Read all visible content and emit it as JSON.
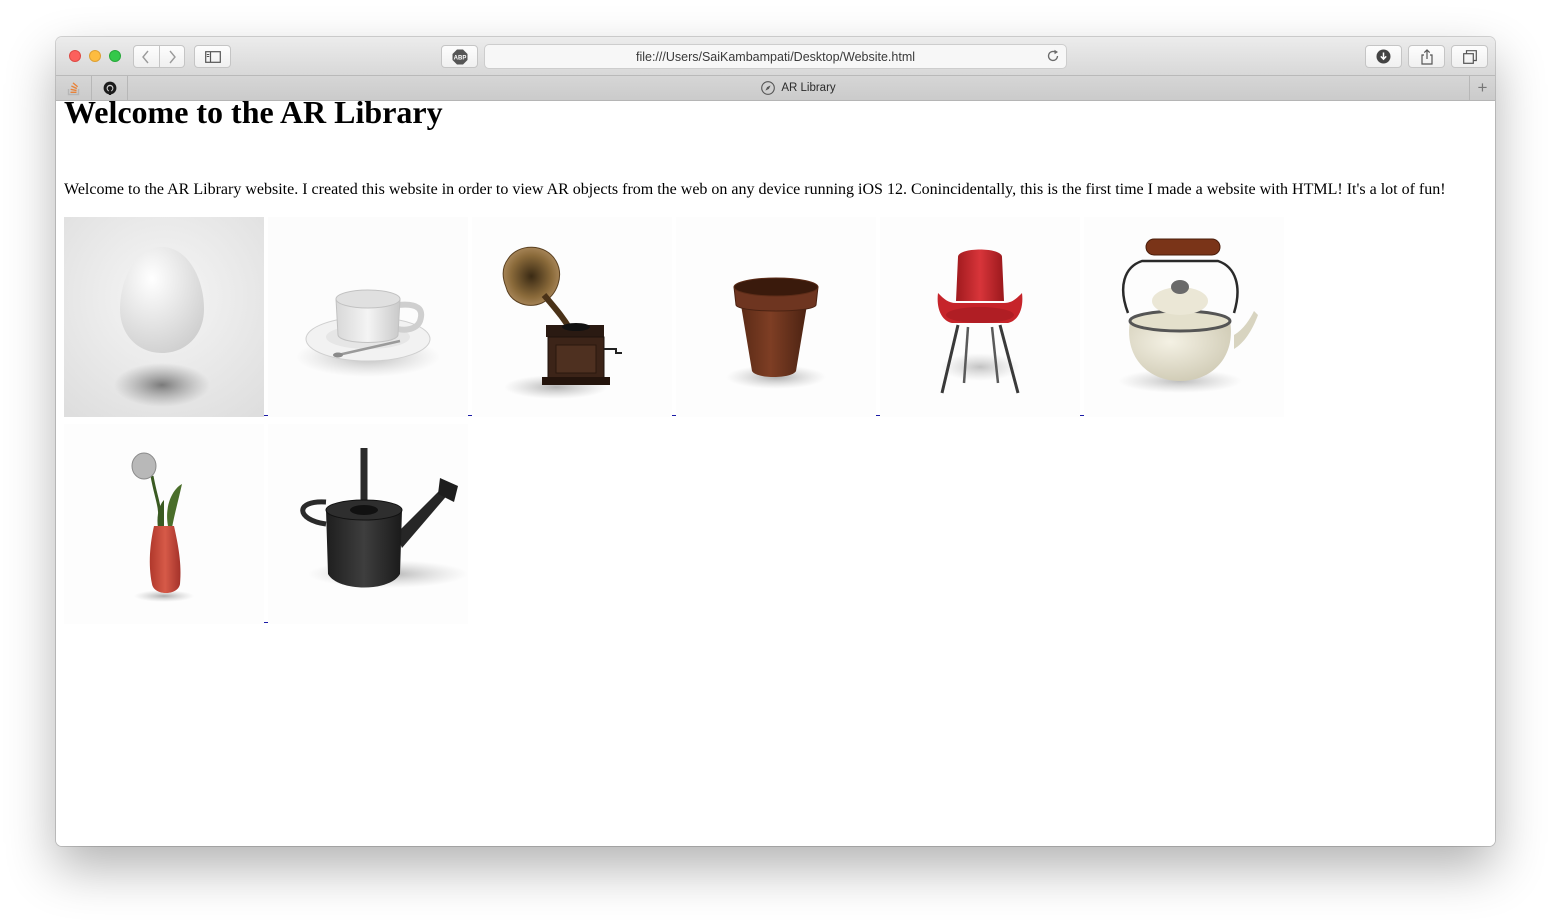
{
  "browser": {
    "address": "file:///Users/SaiKambampati/Desktop/Website.html",
    "tab_title": "AR Library",
    "new_tab_symbol": "+"
  },
  "page": {
    "heading": "Welcome to the AR Library",
    "intro": "Welcome to the AR Library website. I created this website in order to view AR objects from the web on any device running iOS 12. Conincidentally, this is the first time I made a website with HTML! It's a lot of fun!"
  },
  "colors": {
    "chrome": "#dcdcdc",
    "link_underline": "#1a1aa6",
    "chair_red": "#c6242a",
    "pot_brown": "#6e3520",
    "vase_red": "#c9483a"
  },
  "icons": [
    "back-icon",
    "forward-icon",
    "sidebar-icon",
    "adblock-icon",
    "reload-icon",
    "download-icon",
    "share-icon",
    "tabs-icon",
    "stackoverflow-icon",
    "github-icon",
    "compass-icon"
  ],
  "gallery": [
    {
      "object": "egg"
    },
    {
      "object": "cup-and-saucer"
    },
    {
      "object": "gramophone"
    },
    {
      "object": "terracotta-pot"
    },
    {
      "object": "red-chair"
    },
    {
      "object": "teapot"
    },
    {
      "object": "tulip-vase"
    },
    {
      "object": "watering-can"
    }
  ]
}
